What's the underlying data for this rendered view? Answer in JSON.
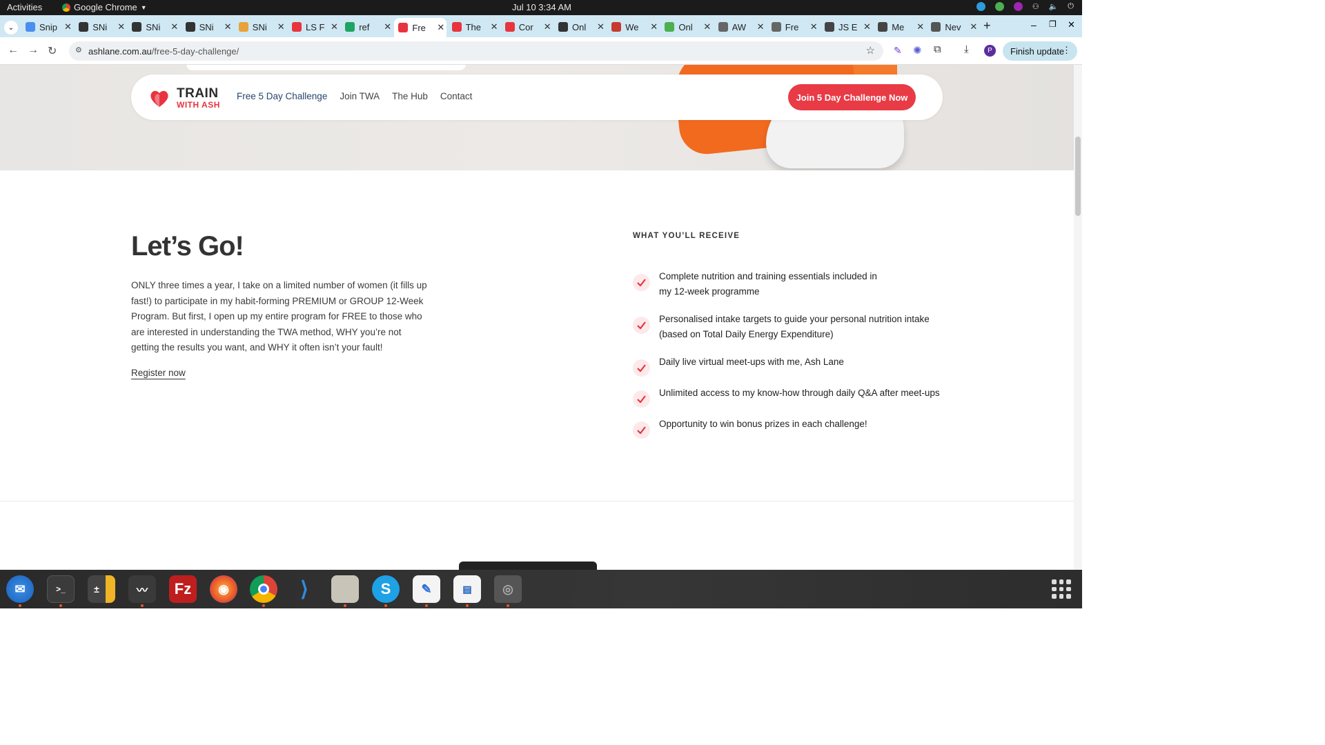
{
  "system_bar": {
    "activities": "Activities",
    "app_name": "Google Chrome",
    "clock": "Jul 10  3:34 AM"
  },
  "tabs": [
    {
      "label": "Snip",
      "color": "#4a8ef0"
    },
    {
      "label": "SNi",
      "color": "#333333"
    },
    {
      "label": "SNi",
      "color": "#333333"
    },
    {
      "label": "SNi",
      "color": "#333333"
    },
    {
      "label": "SNi",
      "color": "#e8a23a"
    },
    {
      "label": "LS F",
      "color": "#e8343f"
    },
    {
      "label": "ref",
      "color": "#1fa463"
    },
    {
      "label": "Fre",
      "color": "#e8343f",
      "active": true
    },
    {
      "label": "The",
      "color": "#e8343f"
    },
    {
      "label": "Cor",
      "color": "#e8343f"
    },
    {
      "label": "Onl",
      "color": "#333333"
    },
    {
      "label": "We",
      "color": "#c63b2f"
    },
    {
      "label": "Onl",
      "color": "#4caf50"
    },
    {
      "label": "AW",
      "color": "#666666"
    },
    {
      "label": "Fre",
      "color": "#666666"
    },
    {
      "label": "JS E",
      "color": "#444444"
    },
    {
      "label": "Me",
      "color": "#444444"
    },
    {
      "label": "Nev",
      "color": "#555555"
    }
  ],
  "address_bar": {
    "url_host": "ashlane.com.au",
    "url_path": "/free-5-day-challenge/",
    "finish_update": "Finish update"
  },
  "site_nav": {
    "logo_line1": "TRAIN",
    "logo_line2": "WITH ASH",
    "links": [
      "Free 5 Day Challenge",
      "Join TWA",
      "The Hub",
      "Contact"
    ],
    "cta": "Join 5 Day Challenge Now"
  },
  "intro": {
    "title": "Let’s Go!",
    "body": "ONLY three times a year, I take on a limited number of women (it fills up fast!) to participate in my habit-forming PREMIUM or GROUP 12-Week Program. But first, I open up my entire program for FREE to those who are interested in understanding the TWA method, WHY you’re not getting the results you want, and WHY it often isn’t your fault!",
    "register_link": "Register now"
  },
  "receive": {
    "heading": "WHAT YOU’LL RECEIVE",
    "items": [
      "Complete nutrition and training essentials included in my 12-week programme",
      "Personalised intake targets to guide your personal nutrition intake (based on Total Daily Energy Expenditure)",
      "Daily live virtual meet-ups with me, Ash Lane",
      "Unlimited access to my know-how through daily Q&A after meet-ups",
      "Opportunity to win bonus prizes in each challenge!"
    ]
  },
  "colors": {
    "brand_red": "#e83b46",
    "nav_current": "#27466b",
    "tab_strip": "#cfe8f3"
  }
}
